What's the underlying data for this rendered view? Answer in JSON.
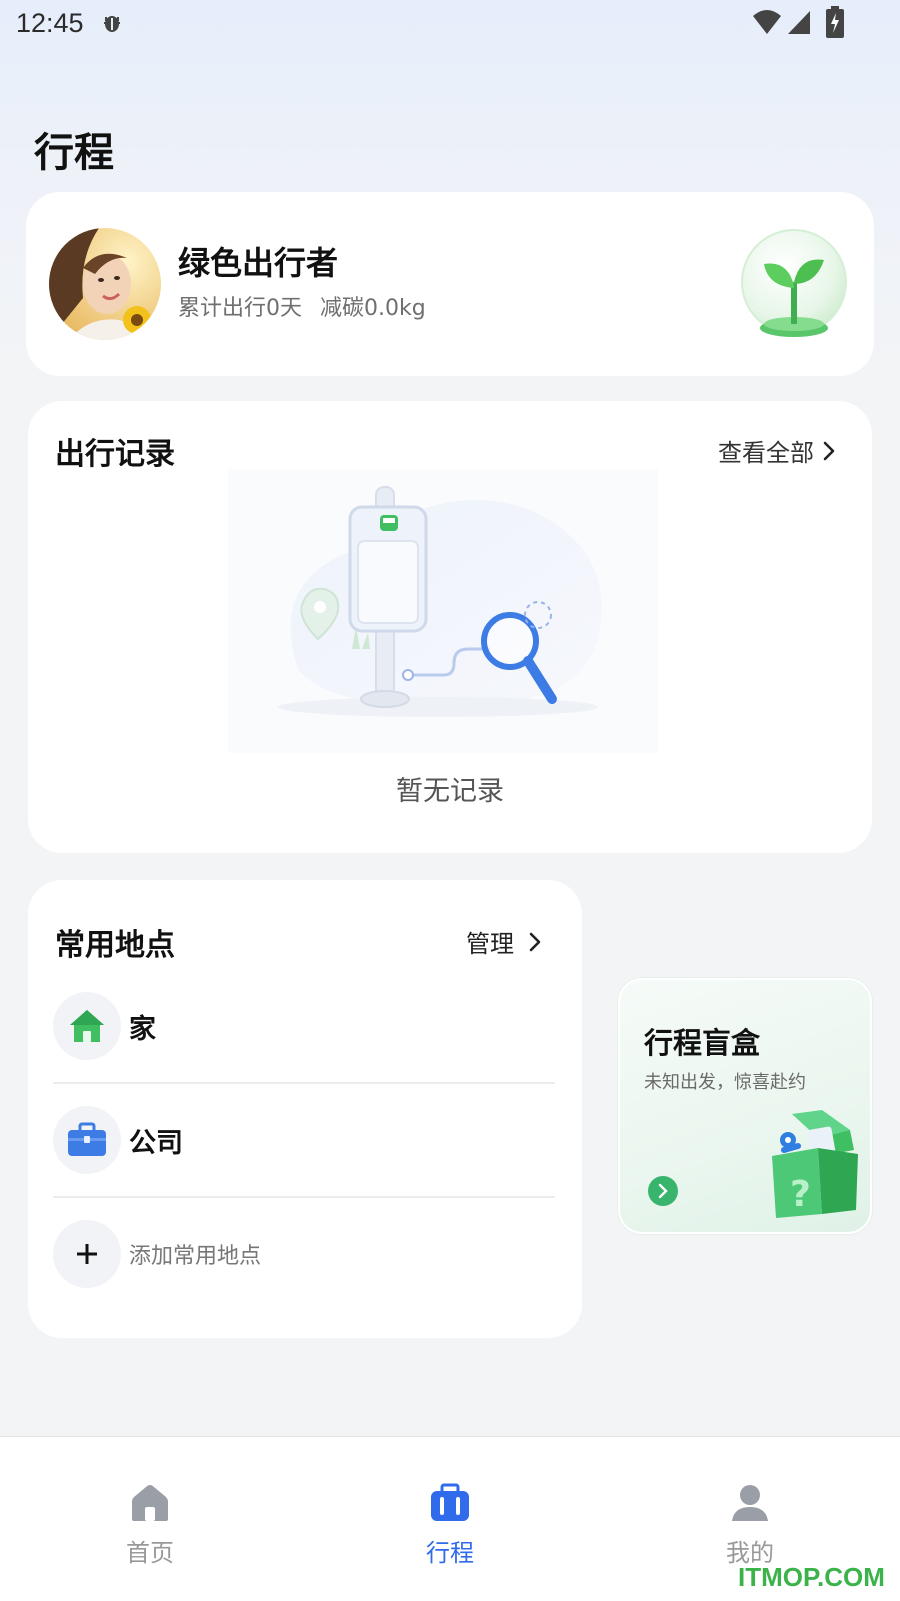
{
  "status_bar": {
    "time": "12:45"
  },
  "page_title": "行程",
  "profile": {
    "name": "绿色出行者",
    "stat_days": "累计出行0天",
    "stat_carbon": "减碳0.0kg"
  },
  "trip_record": {
    "title": "出行记录",
    "view_all": "查看全部",
    "empty_text": "暂无记录"
  },
  "common_places": {
    "title": "常用地点",
    "manage": "管理",
    "items": [
      {
        "label": "家",
        "icon": "home-icon"
      },
      {
        "label": "公司",
        "icon": "briefcase-icon"
      }
    ],
    "add_label": "添加常用地点"
  },
  "blind_box": {
    "title": "行程盲盒",
    "subtitle": "未知出发，惊喜赴约"
  },
  "tabs": [
    {
      "label": "首页",
      "icon": "home-icon",
      "active": false
    },
    {
      "label": "行程",
      "icon": "suitcase-icon",
      "active": true
    },
    {
      "label": "我的",
      "icon": "person-icon",
      "active": false
    }
  ],
  "watermark": "ITMOP.COM",
  "colors": {
    "accent": "#2f6bea",
    "green": "#38b46c",
    "muted": "#999999"
  }
}
